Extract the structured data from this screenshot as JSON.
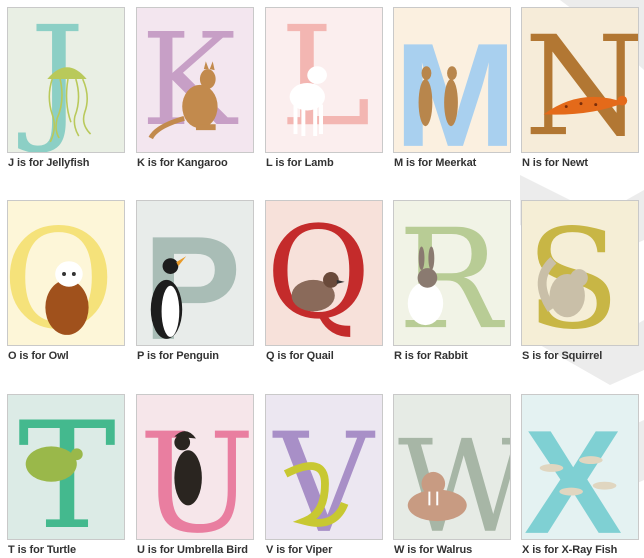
{
  "gallery": {
    "background_color": "#ffffff",
    "cards": [
      {
        "letter": "J",
        "caption": "J is for Jellyfish",
        "bg": "#e9efe4",
        "accent": "#8ccfc5",
        "icon": "jellyfish-icon"
      },
      {
        "letter": "K",
        "caption": "K is for Kangaroo",
        "bg": "#f3e6ef",
        "accent": "#c79fc6",
        "icon": "kangaroo-icon"
      },
      {
        "letter": "L",
        "caption": "L is for Lamb",
        "bg": "#fbeeee",
        "accent": "#f3b6b2",
        "icon": "lamb-icon"
      },
      {
        "letter": "M",
        "caption": "M is for Meerkat",
        "bg": "#fbf0e0",
        "accent": "#a9d0ef",
        "icon": "meerkat-icon"
      },
      {
        "letter": "N",
        "caption": "N is for Newt",
        "bg": "#f6ecd9",
        "accent": "#b27733",
        "icon": "newt-icon"
      },
      {
        "letter": "O",
        "caption": "O is for Owl",
        "bg": "#fdf6d8",
        "accent": "#f5e27a",
        "icon": "owl-icon"
      },
      {
        "letter": "P",
        "caption": "P is for Penguin",
        "bg": "#e8ecea",
        "accent": "#a9bdb6",
        "icon": "penguin-icon"
      },
      {
        "letter": "Q",
        "caption": "Q is for Quail",
        "bg": "#f7e1da",
        "accent": "#c42b2b",
        "icon": "quail-icon"
      },
      {
        "letter": "R",
        "caption": "R is for Rabbit",
        "bg": "#f1f3e6",
        "accent": "#b8cc95",
        "icon": "rabbit-icon"
      },
      {
        "letter": "S",
        "caption": "S is for Squirrel",
        "bg": "#f5eed6",
        "accent": "#c8b645",
        "icon": "squirrel-icon"
      },
      {
        "letter": "T",
        "caption": "T is for Turtle",
        "bg": "#dcebe6",
        "accent": "#44b98e",
        "icon": "turtle-icon"
      },
      {
        "letter": "U",
        "caption": "U is for Umbrella Bird",
        "bg": "#f6e6ea",
        "accent": "#e97ea0",
        "icon": "umbrella-bird-icon"
      },
      {
        "letter": "V",
        "caption": "V is for Viper",
        "bg": "#ece7f1",
        "accent": "#a88fc7",
        "icon": "viper-icon"
      },
      {
        "letter": "W",
        "caption": "W is for Walrus",
        "bg": "#e6ebe5",
        "accent": "#a7b6a6",
        "icon": "walrus-icon"
      },
      {
        "letter": "X",
        "caption": "X is for X-Ray Fish",
        "bg": "#e4f2f2",
        "accent": "#7fd0d3",
        "icon": "x-ray-fish-icon"
      }
    ]
  }
}
